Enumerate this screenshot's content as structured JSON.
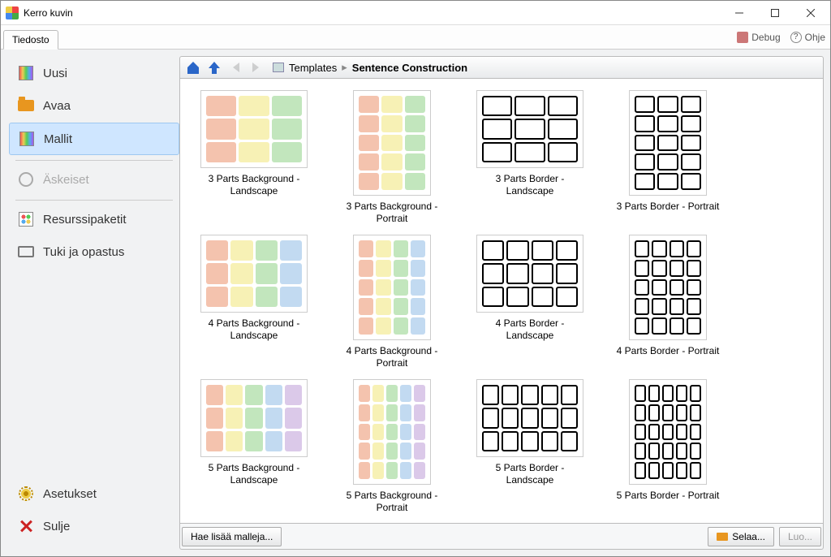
{
  "window": {
    "title": "Kerro kuvin"
  },
  "toolbar": {
    "file_tab": "Tiedosto",
    "debug": "Debug",
    "help": "Ohje"
  },
  "sidebar": {
    "items": [
      {
        "label": "Uusi"
      },
      {
        "label": "Avaa"
      },
      {
        "label": "Mallit"
      },
      {
        "label": "Äskeiset"
      },
      {
        "label": "Resurssipaketit"
      },
      {
        "label": "Tuki ja opastus"
      }
    ],
    "settings": "Asetukset",
    "close": "Sulje"
  },
  "breadcrumb": {
    "root": "Templates",
    "current": "Sentence Construction"
  },
  "templates": [
    {
      "label": "3 Parts Background - Landscape",
      "orient": "landscape",
      "mode": "bg",
      "parts": 3
    },
    {
      "label": "3 Parts Background - Portrait",
      "orient": "portrait",
      "mode": "bg",
      "parts": 3
    },
    {
      "label": "3 Parts Border - Landscape",
      "orient": "landscape",
      "mode": "bd",
      "parts": 3
    },
    {
      "label": "3 Parts Border - Portrait",
      "orient": "portrait",
      "mode": "bd",
      "parts": 3
    },
    {
      "label": "4 Parts Background - Landscape",
      "orient": "landscape",
      "mode": "bg",
      "parts": 4
    },
    {
      "label": "4 Parts Background - Portrait",
      "orient": "portrait",
      "mode": "bg",
      "parts": 4
    },
    {
      "label": "4 Parts Border - Landscape",
      "orient": "landscape",
      "mode": "bd",
      "parts": 4
    },
    {
      "label": "4 Parts Border - Portrait",
      "orient": "portrait",
      "mode": "bd",
      "parts": 4
    },
    {
      "label": "5 Parts Background - Landscape",
      "orient": "landscape",
      "mode": "bg",
      "parts": 5
    },
    {
      "label": "5 Parts Background - Portrait",
      "orient": "portrait",
      "mode": "bg",
      "parts": 5
    },
    {
      "label": "5 Parts Border - Landscape",
      "orient": "landscape",
      "mode": "bd",
      "parts": 5
    },
    {
      "label": "5 Parts Border - Portrait",
      "orient": "portrait",
      "mode": "bd",
      "parts": 5
    }
  ],
  "bottom": {
    "more": "Hae lisää malleja...",
    "browse": "Selaa...",
    "create": "Luo..."
  }
}
